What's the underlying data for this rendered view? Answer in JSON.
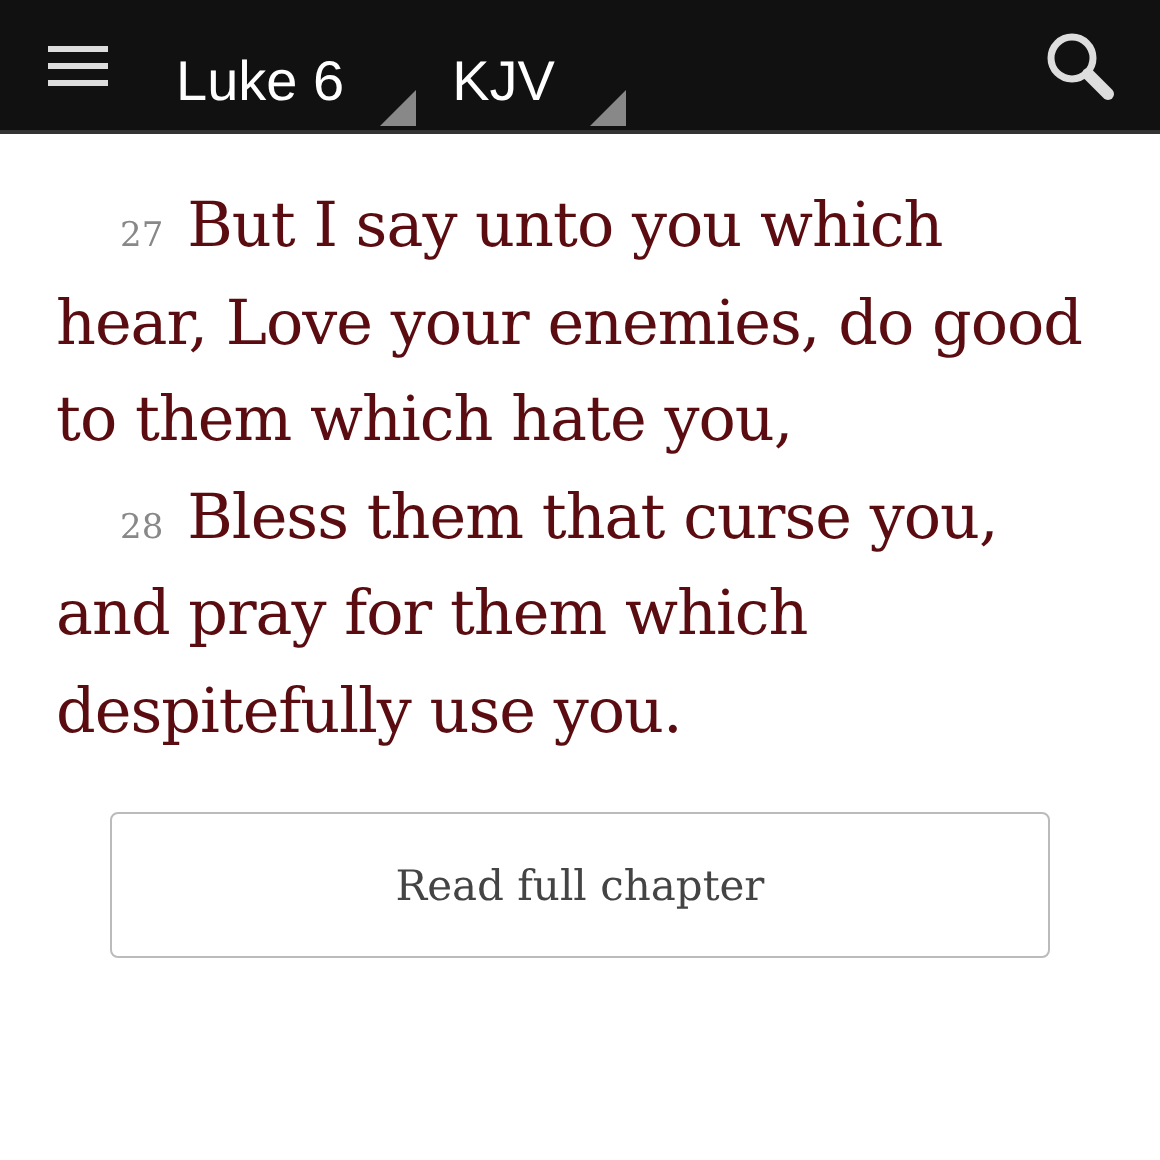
{
  "toolbar": {
    "book": "Luke 6",
    "version": "KJV"
  },
  "verses": [
    {
      "number": "27",
      "text": "But I say unto you which hear, Love your enemies, do good to them which hate you,"
    },
    {
      "number": "28",
      "text": "Bless them that curse you, and pray for them which despitefully use you."
    }
  ],
  "button": "Read full chapter"
}
